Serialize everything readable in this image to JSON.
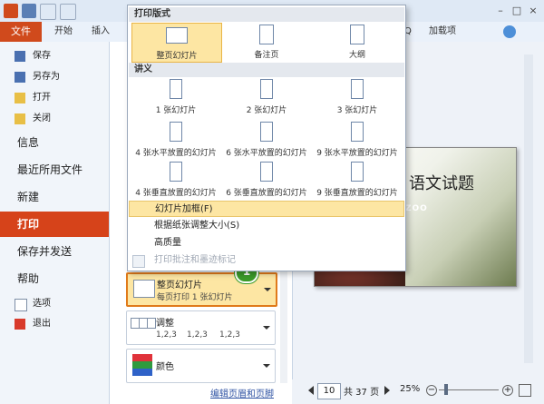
{
  "ribbon": {
    "file_tab": "文件",
    "tabs": [
      "开始",
      "插入"
    ],
    "right_tab_partial": "Q",
    "addins_tab": "加载项"
  },
  "nav": {
    "small_top": [
      {
        "label": "保存",
        "icon": "save-icon"
      },
      {
        "label": "另存为",
        "icon": "save-as-icon"
      },
      {
        "label": "打开",
        "icon": "open-folder-icon"
      },
      {
        "label": "关闭",
        "icon": "close-folder-icon"
      }
    ],
    "big": [
      "信息",
      "最近所用文件",
      "新建",
      "打印",
      "保存并发送",
      "帮助"
    ],
    "small_bottom": [
      {
        "label": "选项",
        "icon": "options-icon"
      },
      {
        "label": "退出",
        "icon": "exit-icon"
      }
    ]
  },
  "dropdown": {
    "layout_header": "打印版式",
    "layout_options": [
      "整页幻灯片",
      "备注页",
      "大纲"
    ],
    "handouts_header": "讲义",
    "handout_options": [
      "1 张幻灯片",
      "2 张幻灯片",
      "3 张幻灯片",
      "4 张水平放置的幻灯片",
      "6 张水平放置的幻灯片",
      "9 张水平放置的幻灯片",
      "4 张垂直放置的幻灯片",
      "6 张垂直放置的幻灯片",
      "9 张垂直放置的幻灯片"
    ],
    "menu_items": [
      "幻灯片加框(F)",
      "根据纸张调整大小(S)",
      "高质量",
      "打印批注和墨迹标记"
    ]
  },
  "settings": {
    "layout_title": "整页幻灯片",
    "layout_sub": "每页打印 1 张幻灯片",
    "collate_title": "调整",
    "collate_sub": [
      "1,2,3",
      "1,2,3",
      "1,2,3"
    ],
    "color_title": "颜色",
    "edit_link": "编辑页眉和页脚",
    "badge": "1"
  },
  "preview": {
    "slide_title": "语文试题",
    "logo_text": "ZOO"
  },
  "status": {
    "page": "10",
    "total": "共 37 页",
    "zoom": "25%"
  },
  "colors": {
    "accent": "#d6431a",
    "highlight": "#fde6a3",
    "callout_orange": "#e07a1a",
    "badge_green": "#3c9b2a"
  }
}
